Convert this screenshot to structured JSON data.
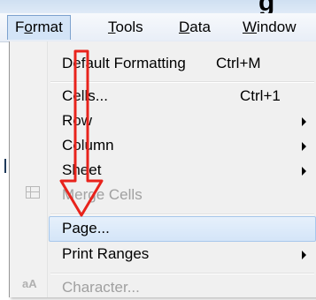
{
  "top_strip": {
    "text": "g"
  },
  "menubar": {
    "items": [
      {
        "label": "Format",
        "underline_index": 1,
        "active": true
      },
      {
        "label": "Tools",
        "underline_index": 0,
        "active": false
      },
      {
        "label": "Data",
        "underline_index": 0,
        "active": false
      },
      {
        "label": "Window",
        "underline_index": 0,
        "active": false
      }
    ]
  },
  "menu": {
    "items": [
      {
        "label": "Default Formatting",
        "shortcut": "Ctrl+M",
        "submenu": false,
        "disabled": false,
        "icon": ""
      },
      {
        "label": "Cells...",
        "shortcut": "Ctrl+1",
        "submenu": false,
        "disabled": false,
        "icon": ""
      },
      {
        "label": "Row",
        "shortcut": "",
        "submenu": true,
        "disabled": false,
        "icon": ""
      },
      {
        "label": "Column",
        "shortcut": "",
        "submenu": true,
        "disabled": false,
        "icon": ""
      },
      {
        "label": "Sheet",
        "shortcut": "",
        "submenu": true,
        "disabled": false,
        "icon": ""
      },
      {
        "label": "Merge Cells",
        "shortcut": "",
        "submenu": false,
        "disabled": true,
        "icon": "merge-cells-icon"
      },
      {
        "label": "Page...",
        "shortcut": "",
        "submenu": false,
        "disabled": false,
        "icon": "",
        "hovered": true
      },
      {
        "label": "Print Ranges",
        "shortcut": "",
        "submenu": true,
        "disabled": false,
        "icon": ""
      },
      {
        "label": "Character...",
        "shortcut": "",
        "submenu": false,
        "disabled": true,
        "icon": "character-icon"
      }
    ]
  },
  "colors": {
    "annotation_arrow": "#e8231c",
    "hover_highlight": "#d4e5f8",
    "disabled_text": "#a0a0a0"
  }
}
